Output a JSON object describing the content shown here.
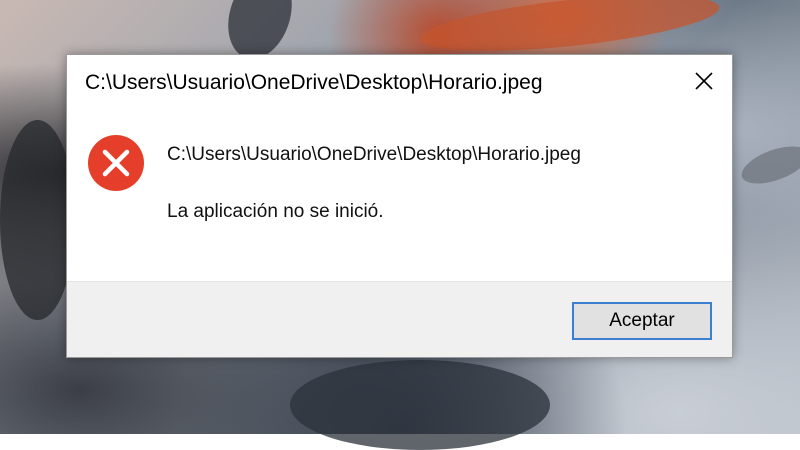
{
  "dialog": {
    "title": "C:\\Users\\Usuario\\OneDrive\\Desktop\\Horario.jpeg",
    "close_icon": "close-icon",
    "status_icon": "error-icon",
    "path_message": "C:\\Users\\Usuario\\OneDrive\\Desktop\\Horario.jpeg",
    "error_message": "La aplicación no se inició.",
    "ok_label": "Aceptar"
  },
  "colors": {
    "error_red": "#e53f2b",
    "button_focus_border": "#3c7fd0",
    "footer_bg": "#f0f0f0"
  }
}
